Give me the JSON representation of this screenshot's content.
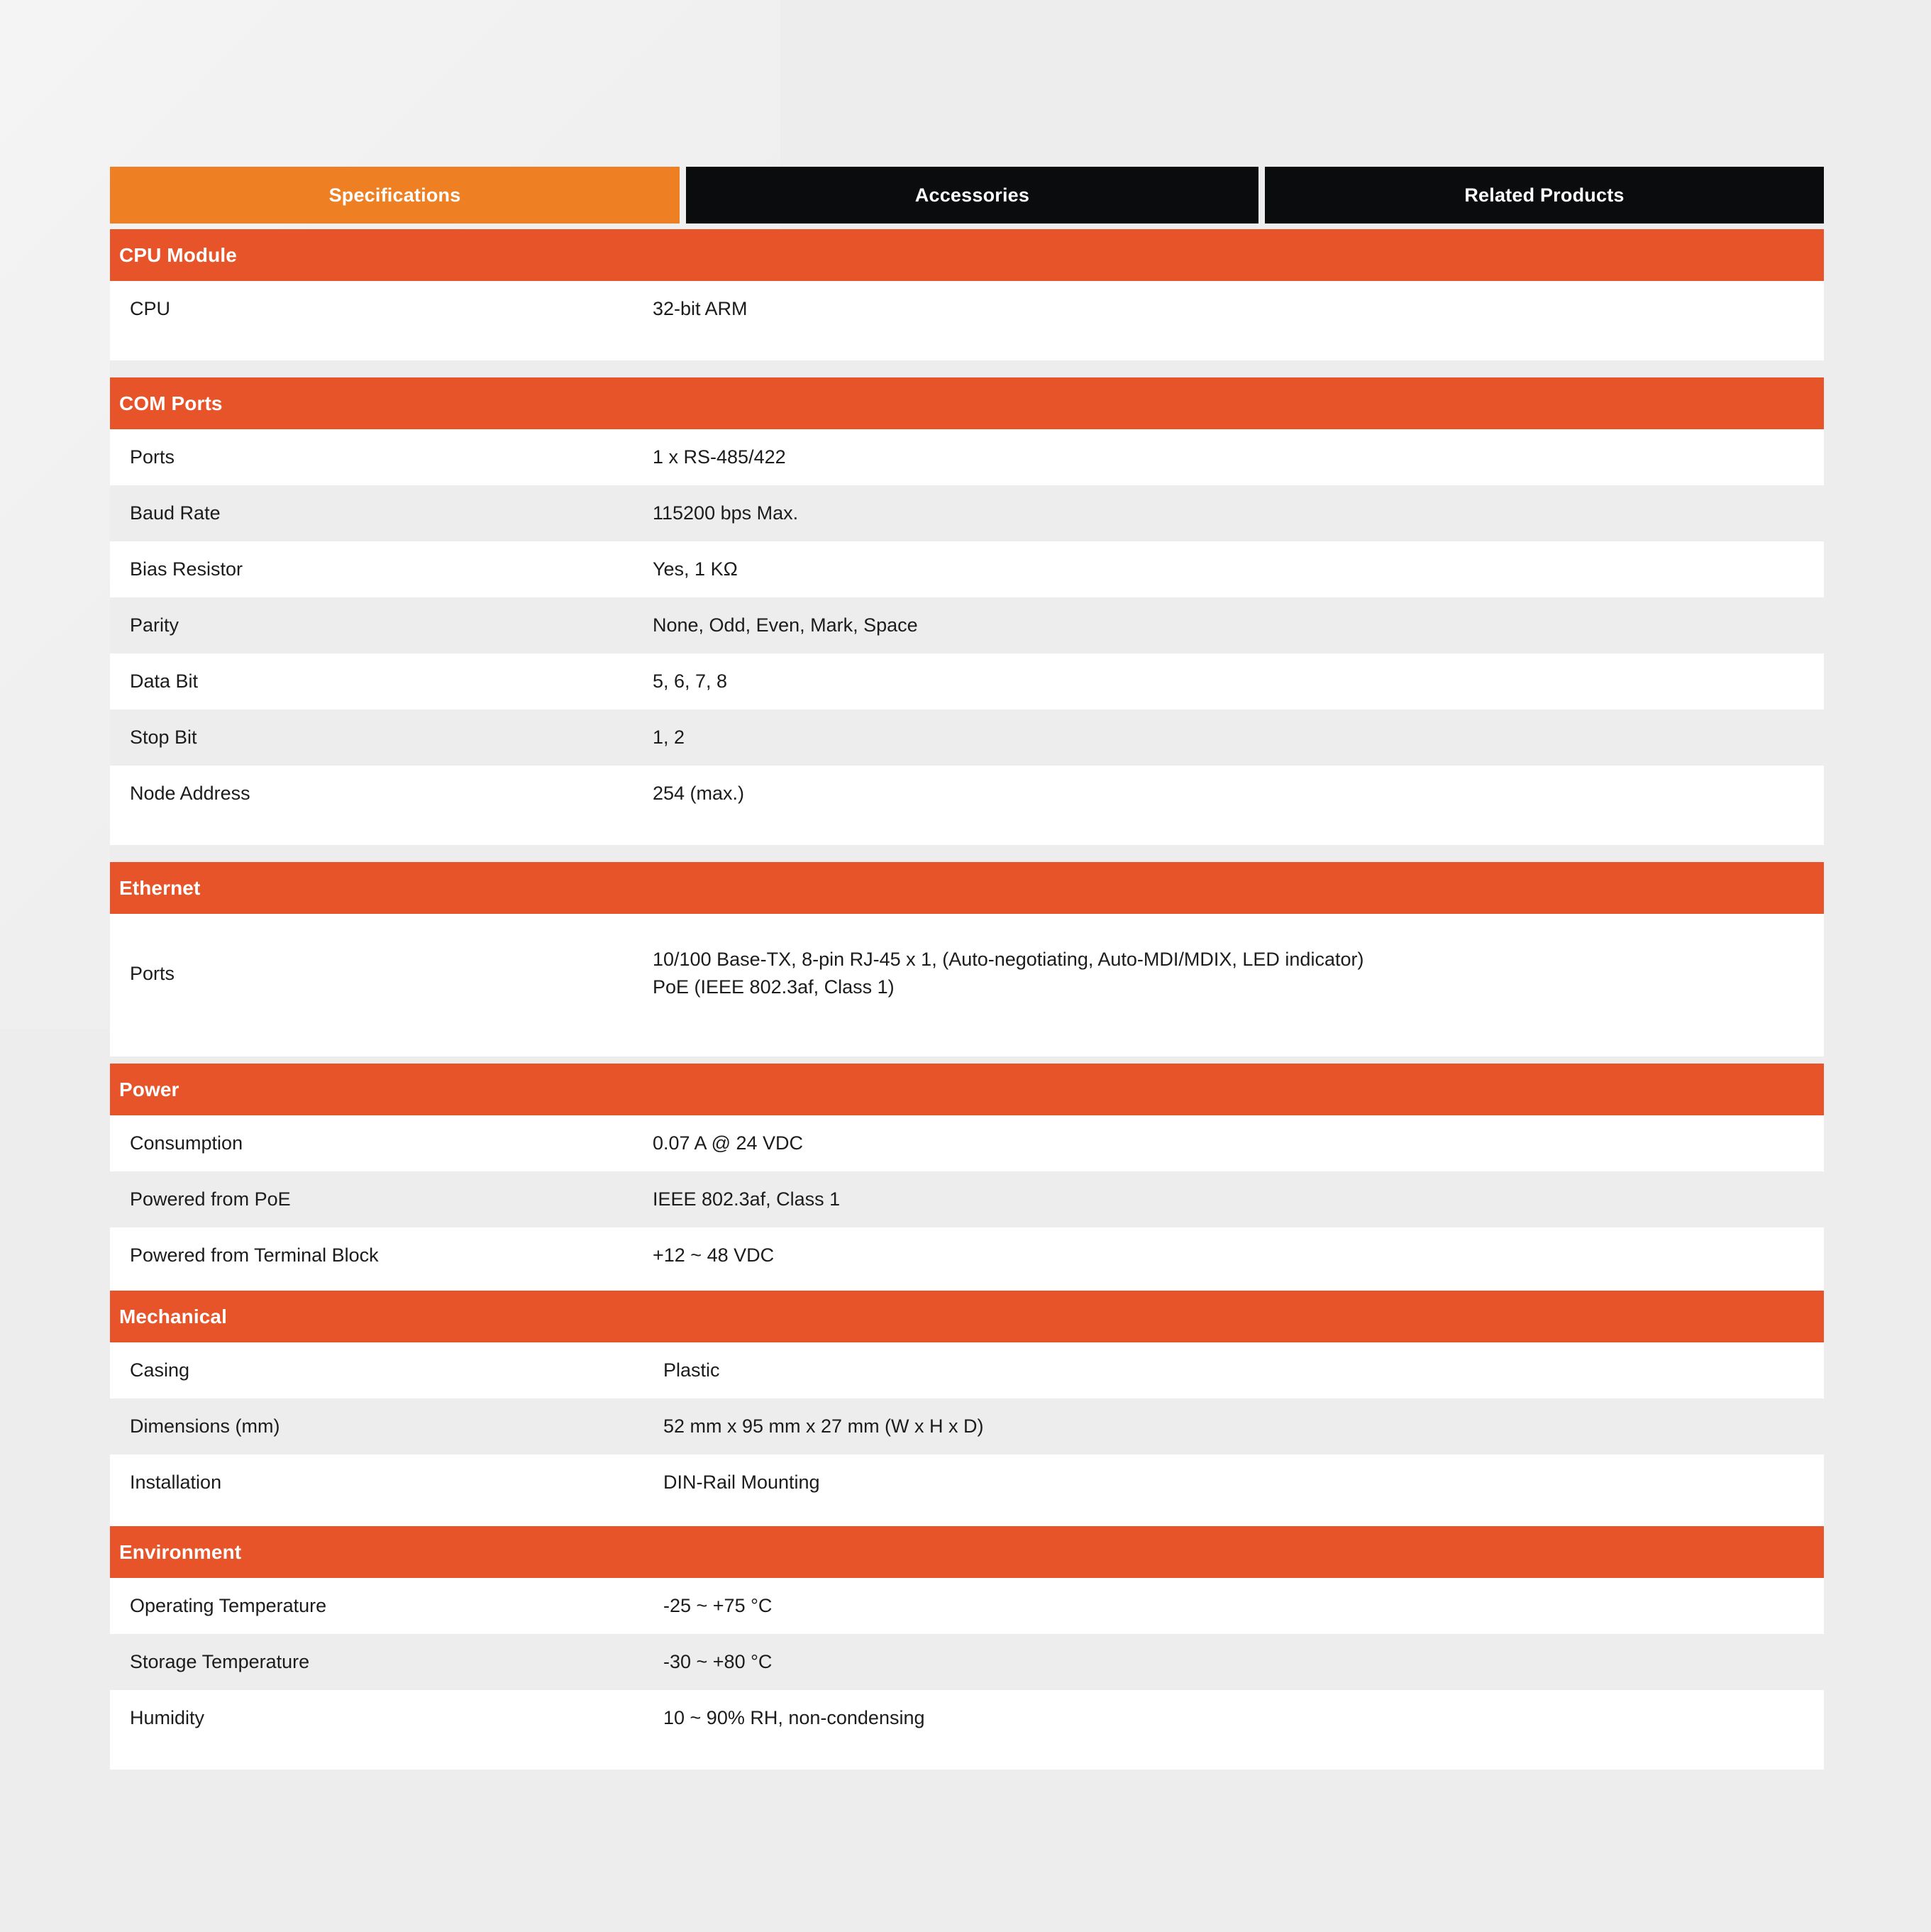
{
  "tabs": [
    {
      "label": "Specifications",
      "active": true
    },
    {
      "label": "Accessories",
      "active": false
    },
    {
      "label": "Related Products",
      "active": false
    }
  ],
  "colors": {
    "tab_active": "#EE7F22",
    "tab_inactive": "#0A0C0D",
    "section_header": "#E8542A",
    "page_background": "#EDEDEE",
    "row_background": "#FFFFFF",
    "row_alt_background": "#EDEDEE",
    "text": "#1C1C1C",
    "header_text": "#FFFFFF"
  },
  "sections": [
    {
      "title": "CPU Module",
      "rows": [
        {
          "key": "CPU",
          "value": "32-bit ARM"
        }
      ]
    },
    {
      "title": "COM Ports",
      "rows": [
        {
          "key": "Ports",
          "value": "1 x RS-485/422"
        },
        {
          "key": "Baud Rate",
          "value": "115200 bps Max."
        },
        {
          "key": "Bias Resistor",
          "value": "Yes, 1 KΩ"
        },
        {
          "key": "Parity",
          "value": "None, Odd, Even, Mark, Space"
        },
        {
          "key": "Data Bit",
          "value": "5, 6, 7, 8"
        },
        {
          "key": "Stop Bit",
          "value": "1, 2"
        },
        {
          "key": "Node Address",
          "value": "254 (max.)"
        }
      ]
    },
    {
      "title": "Ethernet",
      "rows": [
        {
          "key": "Ports",
          "value": "10/100 Base-TX, 8-pin RJ-45 x 1, (Auto-negotiating, Auto-MDI/MDIX, LED indicator)\nPoE (IEEE 802.3af, Class 1)"
        }
      ]
    },
    {
      "title": "Power",
      "rows": [
        {
          "key": "Consumption",
          "value": "0.07 A @ 24 VDC"
        },
        {
          "key": "Powered from PoE",
          "value": "IEEE 802.3af, Class 1"
        },
        {
          "key": "Powered from Terminal Block",
          "value": "+12 ~ 48 VDC"
        }
      ]
    },
    {
      "title": "Mechanical",
      "rows": [
        {
          "key": "Casing",
          "value": "Plastic"
        },
        {
          "key": "Dimensions (mm)",
          "value": "52 mm x 95 mm x 27 mm (W x H x D)"
        },
        {
          "key": "Installation",
          "value": "DIN-Rail Mounting"
        }
      ]
    },
    {
      "title": "Environment",
      "rows": [
        {
          "key": "Operating Temperature",
          "value": "-25 ~ +75 °C"
        },
        {
          "key": "Storage Temperature",
          "value": "-30 ~ +80 °C"
        },
        {
          "key": "Humidity",
          "value": "10 ~ 90% RH, non-condensing"
        }
      ]
    }
  ]
}
